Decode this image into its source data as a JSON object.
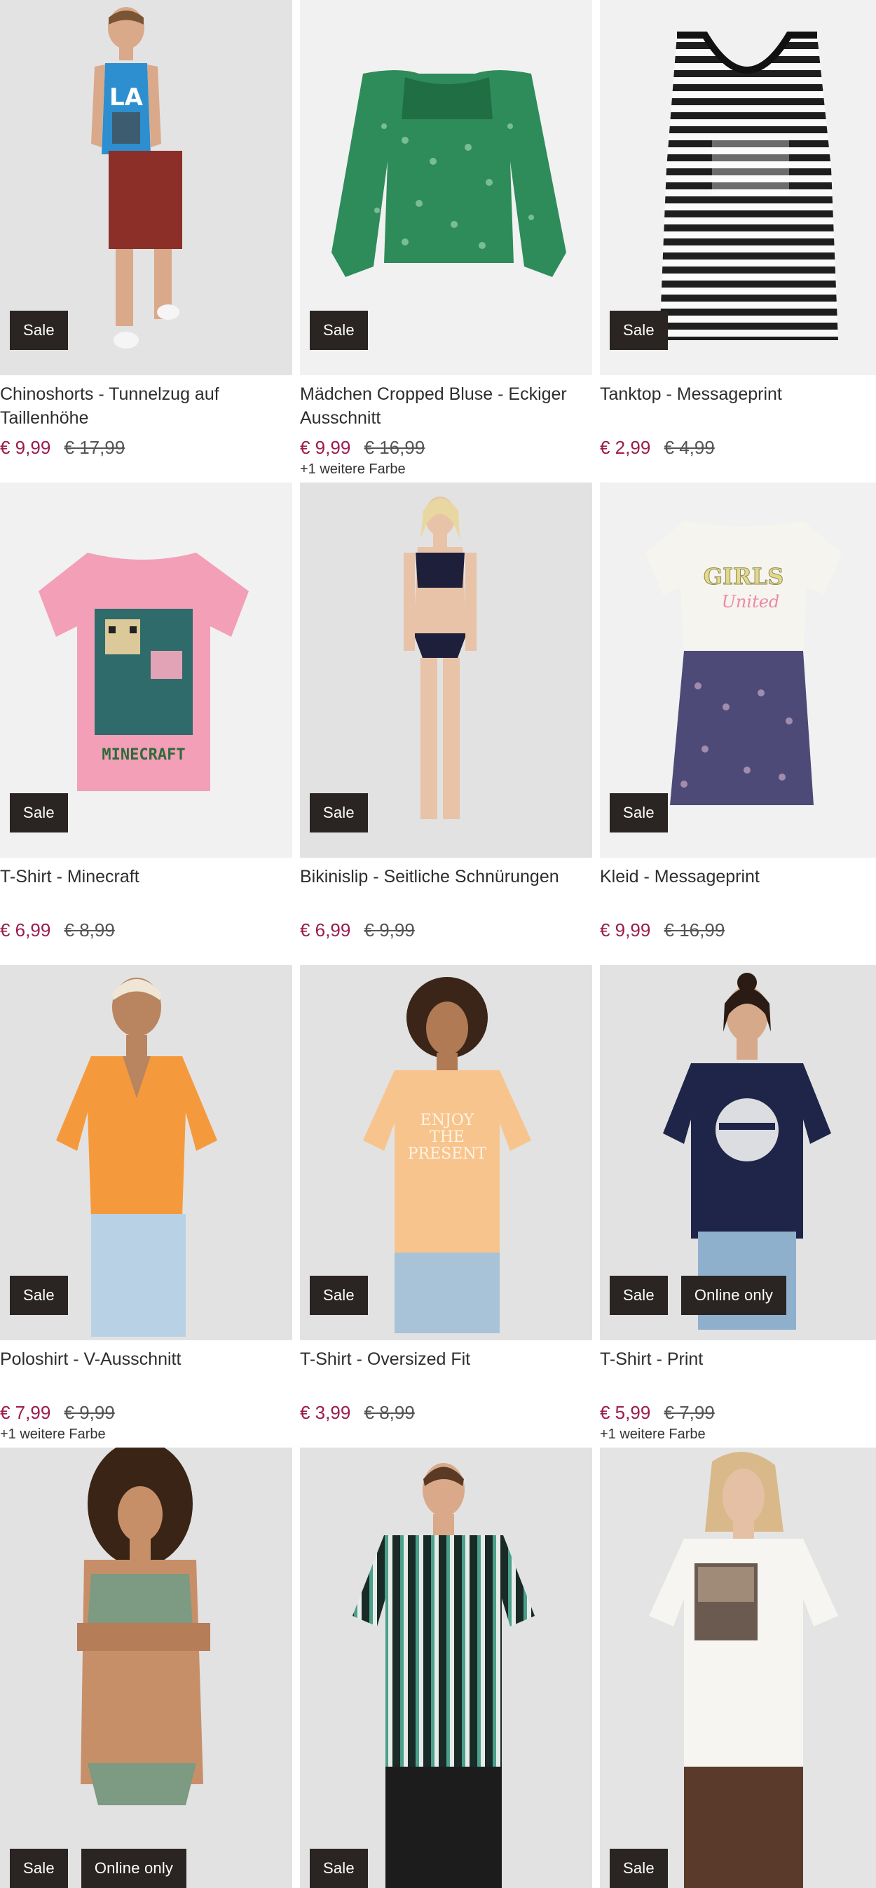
{
  "colors": {
    "badge_bg": "#2a2523",
    "price_sale": "#9c1c4e",
    "price_old": "#555555",
    "image_bg": "#f1f1f1"
  },
  "products": [
    {
      "title": "Chinoshorts - Tunnelzug auf Taillenhöhe",
      "price": "€ 9,99",
      "old_price": "€ 17,99",
      "badges": [
        "Sale"
      ],
      "more_colors": "",
      "image": "man-tanktop-shorts"
    },
    {
      "title": "Mädchen Cropped Bluse - Eckiger Ausschnitt",
      "price": "€ 9,99",
      "old_price": "€ 16,99",
      "badges": [
        "Sale"
      ],
      "more_colors": "+1 weitere Farbe",
      "image": "green-floral-blouse"
    },
    {
      "title": "Tanktop - Messageprint",
      "price": "€ 2,99",
      "old_price": "€ 4,99",
      "badges": [
        "Sale"
      ],
      "more_colors": "",
      "image": "striped-tanktop"
    },
    {
      "title": "T-Shirt - Minecraft",
      "price": "€ 6,99",
      "old_price": "€ 8,99",
      "badges": [
        "Sale"
      ],
      "more_colors": "",
      "image": "pink-minecraft-tshirt"
    },
    {
      "title": "Bikinislip - Seitliche Schnürungen",
      "price": "€ 6,99",
      "old_price": "€ 9,99",
      "badges": [
        "Sale"
      ],
      "more_colors": "",
      "image": "woman-bikini"
    },
    {
      "title": "Kleid - Messageprint",
      "price": "€ 9,99",
      "old_price": "€ 16,99",
      "badges": [
        "Sale"
      ],
      "more_colors": "",
      "image": "girls-dress"
    },
    {
      "title": "Poloshirt - V-Ausschnitt",
      "price": "€ 7,99",
      "old_price": "€ 9,99",
      "badges": [
        "Sale"
      ],
      "more_colors": "+1 weitere Farbe",
      "image": "woman-orange-polo"
    },
    {
      "title": "T-Shirt - Oversized Fit",
      "price": "€ 3,99",
      "old_price": "€ 8,99",
      "badges": [
        "Sale"
      ],
      "more_colors": "",
      "image": "woman-peach-tshirt"
    },
    {
      "title": "T-Shirt - Print",
      "price": "€ 5,99",
      "old_price": "€ 7,99",
      "badges": [
        "Sale",
        "Online only"
      ],
      "more_colors": "+1 weitere Farbe",
      "image": "woman-navy-tshirt"
    },
    {
      "title": "",
      "price": "",
      "old_price": "",
      "badges": [
        "Sale",
        "Online only"
      ],
      "more_colors": "",
      "image": "woman-green-bikini"
    },
    {
      "title": "",
      "price": "",
      "old_price": "",
      "badges": [
        "Sale"
      ],
      "more_colors": "",
      "image": "man-striped-tshirt"
    },
    {
      "title": "",
      "price": "",
      "old_price": "",
      "badges": [
        "Sale"
      ],
      "more_colors": "",
      "image": "woman-white-tshirt"
    }
  ],
  "artwork": {
    "tank_print": "LA",
    "tshirt_print": "MINECRAFT",
    "dress_print_1": "GIRLS",
    "dress_print_2": "United",
    "tee_print_1": "ENJOY",
    "tee_print_2": "THE",
    "tee_print_3": "PRESENT"
  }
}
